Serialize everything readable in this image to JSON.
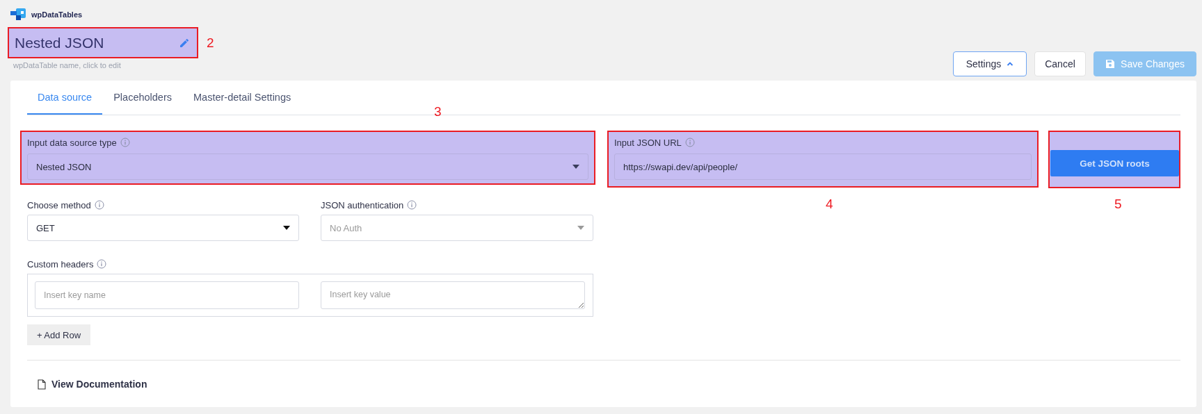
{
  "app": {
    "name": "wpDataTables"
  },
  "table_name": {
    "value": "Nested JSON",
    "hint": "wpDataTable name, click to edit",
    "callout": "2"
  },
  "actions": [
    {
      "label": "Settings",
      "kind": "settings"
    },
    {
      "label": "Cancel",
      "kind": "cancel"
    },
    {
      "label": "Save Changes",
      "kind": "save",
      "disabled": true
    }
  ],
  "tabs": [
    {
      "label": "Data source",
      "selected": true
    },
    {
      "label": "Placeholders",
      "selected": false
    },
    {
      "label": "Master-detail Settings",
      "selected": false
    }
  ],
  "source_type": {
    "label": "Input data source type",
    "value": "Nested JSON",
    "callout": "3"
  },
  "json_url": {
    "label": "Input JSON URL",
    "value": "https://swapi.dev/api/people/",
    "callout": "4"
  },
  "get_roots": {
    "label": "Get JSON roots",
    "callout": "5"
  },
  "method": {
    "label": "Choose method",
    "value": "GET",
    "disabled": false
  },
  "authentication": {
    "label": "JSON authentication",
    "value": "No Auth",
    "disabled": true
  },
  "custom_headers": {
    "label": "Custom headers",
    "fields": [
      {
        "kind": "input",
        "placeholder": "Insert key name"
      },
      {
        "kind": "textarea",
        "placeholder": "Insert key value"
      }
    ]
  },
  "add_row": {
    "label": "+ Add Row"
  },
  "documentation": {
    "label": "View Documentation"
  }
}
